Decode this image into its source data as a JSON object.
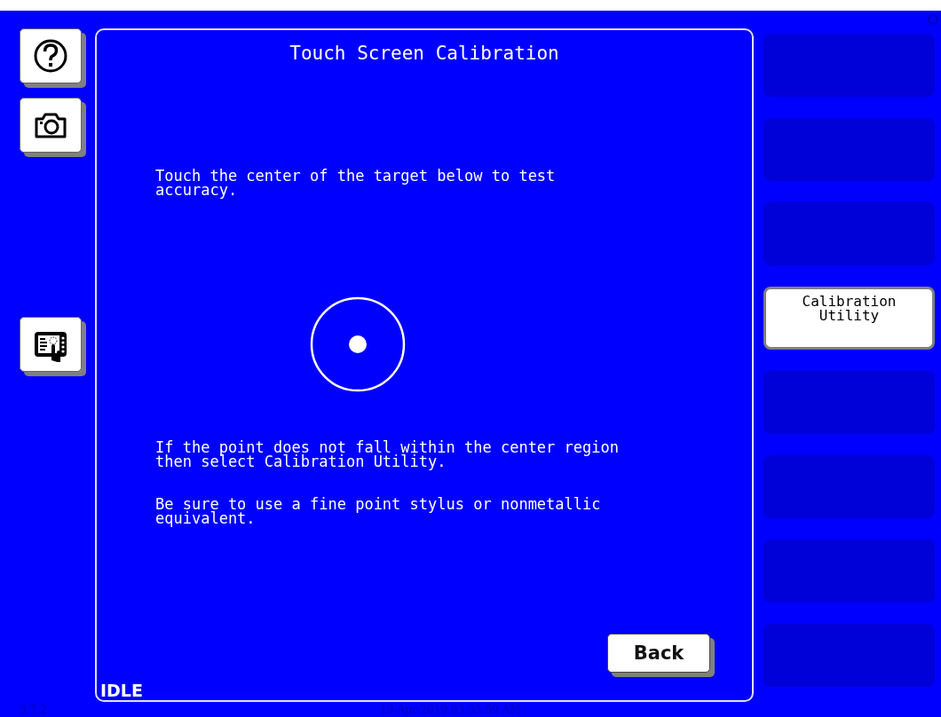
{
  "side_buttons": [
    {
      "kind": "help"
    },
    {
      "kind": "camera"
    },
    {
      "kind": "touchscreen"
    }
  ],
  "panel": {
    "title": "Touch Screen Calibration",
    "instruction": "Touch the center of the target below to test accuracy.",
    "notes": [
      "If the point does not fall within the center region then select Calibration Utility.",
      "Be sure to use a fine point stylus or nonmetallic equivalent."
    ],
    "back_button": "Back",
    "status": "IDLE"
  },
  "soft_keys": [
    {
      "kind": "blank"
    },
    {
      "kind": "blank"
    },
    {
      "kind": "blank"
    },
    {
      "kind": "button",
      "label": "Calibration Utility"
    },
    {
      "kind": "blank"
    },
    {
      "kind": "blank"
    },
    {
      "kind": "blank"
    },
    {
      "kind": "blank"
    }
  ],
  "footer": {
    "version": "3.7.2",
    "datetime": "19-Apr-2019 03:35:59 AM"
  }
}
